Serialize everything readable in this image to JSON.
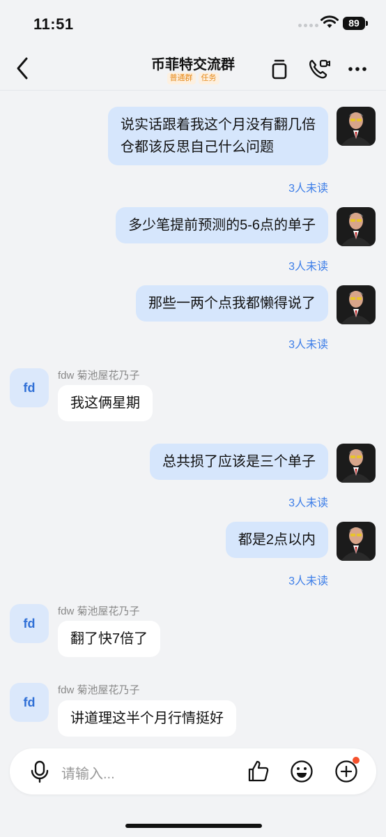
{
  "status": {
    "time": "11:51",
    "battery": "89"
  },
  "header": {
    "title": "币菲特交流群",
    "tags": [
      "普通群",
      "任务"
    ]
  },
  "messages": [
    {
      "side": "right",
      "text_lines": [
        "说实话跟着我这个月没有翻几倍",
        "仓都该反思自己什么问题"
      ],
      "status": "3人未读"
    },
    {
      "side": "right",
      "text": "多少笔提前预测的5-6点的单子",
      "status": "3人未读"
    },
    {
      "side": "right",
      "text": "那些一两个点我都懒得说了",
      "status": "3人未读"
    },
    {
      "side": "left",
      "sender": "fdw 菊池屋花乃子",
      "avatar": "fd",
      "text": "我这俩星期"
    },
    {
      "side": "right",
      "text": "总共损了应该是三个单子",
      "status": "3人未读"
    },
    {
      "side": "right",
      "text": "都是2点以内",
      "status": "3人未读"
    },
    {
      "side": "left",
      "sender": "fdw 菊池屋花乃子",
      "avatar": "fd",
      "text": "翻了快7倍了"
    },
    {
      "side": "left",
      "sender": "fdw 菊池屋花乃子",
      "avatar": "fd",
      "text": "讲道理这半个月行情挺好"
    }
  ],
  "input": {
    "placeholder": "请输入..."
  },
  "colors": {
    "bubble_right": "#d6e6fc",
    "accent": "#3d7ee8",
    "tag": "#e68a1a",
    "badge_dot": "#f5522d"
  }
}
